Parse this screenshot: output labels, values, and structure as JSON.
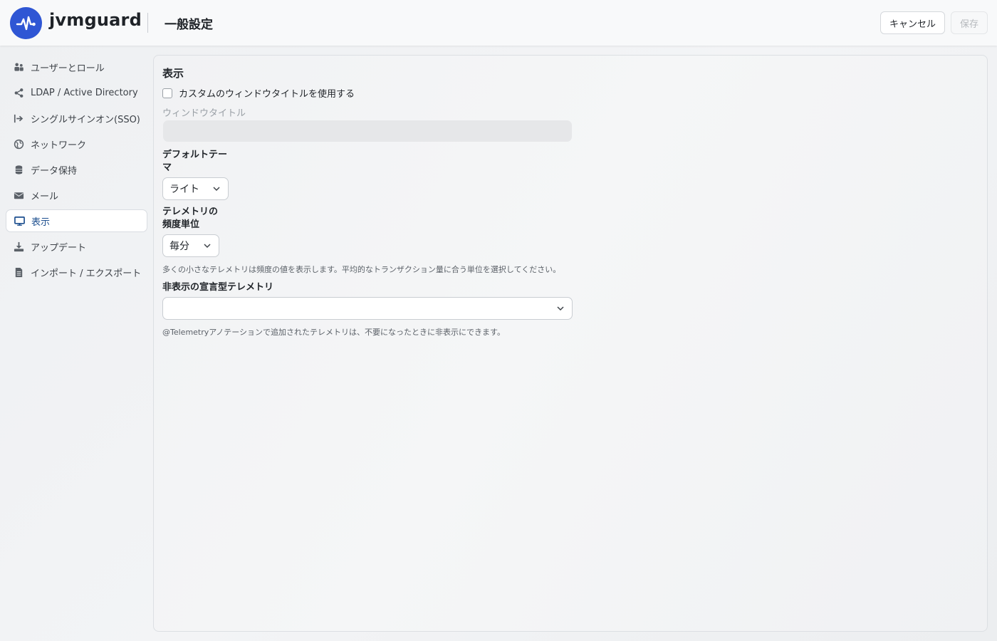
{
  "header": {
    "brand": "jvmguard",
    "page_title": "一般設定",
    "cancel_label": "キャンセル",
    "save_label": "保存",
    "accent_color": "#2f56d4"
  },
  "sidebar": {
    "items": [
      {
        "label": "ユーザーとロール",
        "icon": "users-icon",
        "active": false
      },
      {
        "label": "LDAP / Active Directory",
        "icon": "share-icon",
        "active": false
      },
      {
        "label": "シングルサインオン(SSO)",
        "icon": "sign-in-icon",
        "active": false
      },
      {
        "label": "ネットワーク",
        "icon": "globe-icon",
        "active": false
      },
      {
        "label": "データ保持",
        "icon": "database-icon",
        "active": false
      },
      {
        "label": "メール",
        "icon": "envelope-icon",
        "active": false
      },
      {
        "label": "表示",
        "icon": "monitor-icon",
        "active": true
      },
      {
        "label": "アップデート",
        "icon": "download-icon",
        "active": false
      },
      {
        "label": "インポート / エクスポート",
        "icon": "file-icon",
        "active": false
      }
    ]
  },
  "main": {
    "section_title": "表示",
    "custom_title_checkbox": {
      "label": "カスタムのウィンドウタイトルを使用する",
      "checked": false
    },
    "window_title_label": "ウィンドウタイトル",
    "window_title_value": "",
    "default_theme": {
      "label_line1": "デフォルトテー",
      "label_line2": "マ",
      "value": "ライト"
    },
    "telemetry_unit": {
      "label_line1": "テレメトリの",
      "label_line2": "頻度単位",
      "value": "毎分",
      "help": "多くの小さなテレメトリは頻度の値を表示します。平均的なトランザクション量に合う単位を選択してください。"
    },
    "hidden_telemetry": {
      "label": "非表示の宣言型テレメトリ",
      "value": "",
      "help": "@Telemetryアノテーションで追加されたテレメトリは、不要になったときに非表示にできます。"
    }
  }
}
